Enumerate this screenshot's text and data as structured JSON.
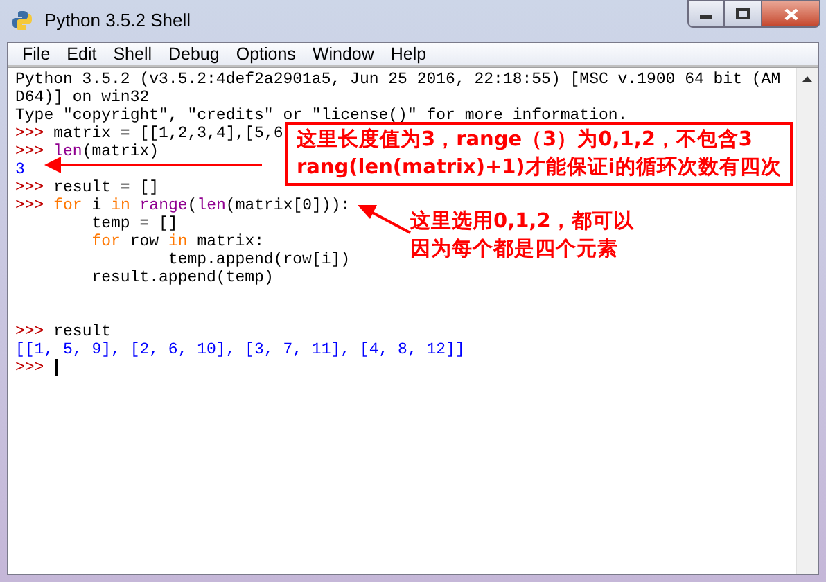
{
  "window": {
    "title": "Python 3.5.2 Shell"
  },
  "menu": [
    "File",
    "Edit",
    "Shell",
    "Debug",
    "Options",
    "Window",
    "Help"
  ],
  "shell_lines": [
    [
      {
        "kind": "plain",
        "text": "Python 3.5.2 (v3.5.2:4def2a2901a5, Jun 25 2016, 22:18:55) [MSC v.1900 64 bit (AM"
      }
    ],
    [
      {
        "kind": "plain",
        "text": "D64)] on win32"
      }
    ],
    [
      {
        "kind": "plain",
        "text": "Type \"copyright\", \"credits\" or \"license()\" for more information."
      }
    ],
    [
      {
        "kind": "prompt",
        "text": ">>> "
      },
      {
        "kind": "plain",
        "text": "matrix = [[1,2,3,4],[5,6"
      }
    ],
    [
      {
        "kind": "prompt",
        "text": ">>> "
      },
      {
        "kind": "builtin",
        "text": "len"
      },
      {
        "kind": "plain",
        "text": "(matrix)"
      }
    ],
    [
      {
        "kind": "output",
        "text": "3"
      }
    ],
    [
      {
        "kind": "prompt",
        "text": ">>> "
      },
      {
        "kind": "plain",
        "text": "result = []"
      }
    ],
    [
      {
        "kind": "prompt",
        "text": ">>> "
      },
      {
        "kind": "keyword",
        "text": "for"
      },
      {
        "kind": "plain",
        "text": " i "
      },
      {
        "kind": "keyword",
        "text": "in"
      },
      {
        "kind": "builtin",
        "text": " range"
      },
      {
        "kind": "plain",
        "text": "("
      },
      {
        "kind": "builtin",
        "text": "len"
      },
      {
        "kind": "plain",
        "text": "(matrix[0])):"
      }
    ],
    [
      {
        "kind": "plain",
        "text": "        temp = []"
      }
    ],
    [
      {
        "kind": "keyword",
        "text": "        for"
      },
      {
        "kind": "plain",
        "text": " row "
      },
      {
        "kind": "keyword",
        "text": "in"
      },
      {
        "kind": "plain",
        "text": " matrix:"
      }
    ],
    [
      {
        "kind": "plain",
        "text": "                temp.append(row[i])"
      }
    ],
    [
      {
        "kind": "plain",
        "text": "        result.append(temp)"
      }
    ],
    [
      {
        "kind": "blank"
      }
    ],
    [
      {
        "kind": "blank"
      }
    ],
    [
      {
        "kind": "prompt",
        "text": ">>> "
      },
      {
        "kind": "plain",
        "text": "result"
      }
    ],
    [
      {
        "kind": "output",
        "text": "[[1, 5, 9], [2, 6, 10], [3, 7, 11], [4, 8, 12]]"
      }
    ],
    [
      {
        "kind": "prompt",
        "text": ">>> "
      },
      {
        "kind": "cursor"
      }
    ]
  ],
  "annotations": [
    {
      "kind": "boxed",
      "lines": [
        "这里长度值为3，range（3）为0,1,2，不包含3",
        "rang(len(matrix)+1)才能保证i的循环次数有四次"
      ]
    },
    {
      "kind": "plain",
      "lines": [
        "这里选用0,1,2，都可以",
        "因为每个都是四个元素"
      ]
    }
  ]
}
